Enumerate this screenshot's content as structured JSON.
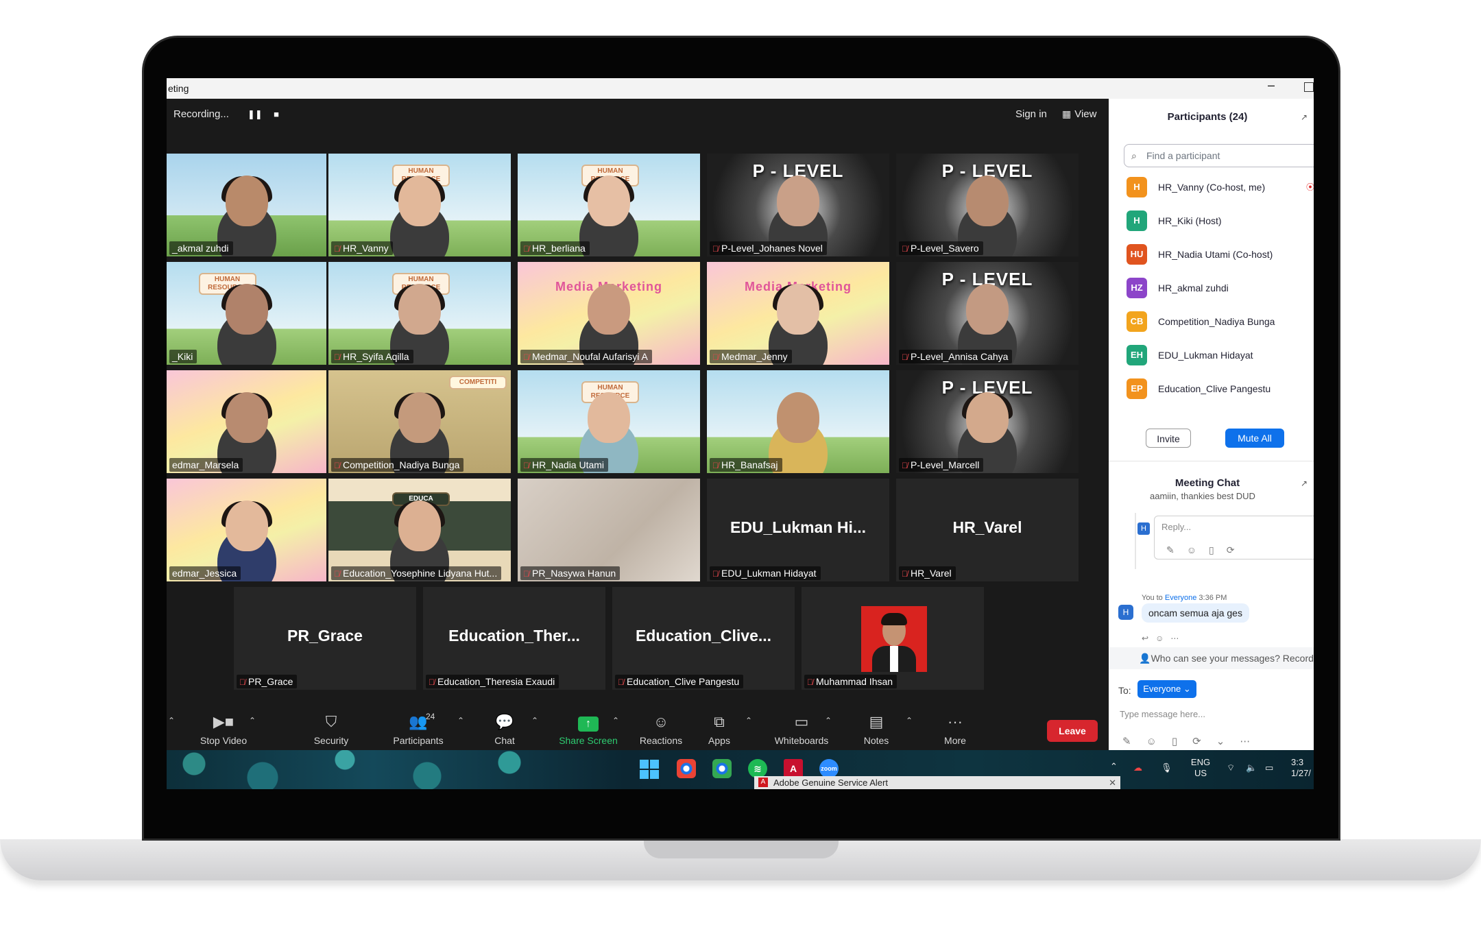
{
  "window": {
    "title": "eting"
  },
  "topbar": {
    "recording_label": "Recording...",
    "pause_icon": "pause-icon",
    "stop_icon": "stop-icon",
    "signin_label": "Sign in",
    "view_label": "View"
  },
  "tiles": [
    {
      "name": "_akmal zuhdi",
      "active": true,
      "muted": false
    },
    {
      "name": "HR_Vanny",
      "muted": true
    },
    {
      "name": "HR_berliana",
      "muted": true
    },
    {
      "name": "P-Level_Johanes Novel",
      "muted": true,
      "banner": "P - LEVEL"
    },
    {
      "name": "P-Level_Savero",
      "muted": true,
      "banner": "P - LEVEL"
    },
    {
      "name": "_Kiki",
      "muted": false
    },
    {
      "name": "HR_Syifa Aqilla",
      "muted": true
    },
    {
      "name": "Medmar_Noufal Aufarisyi A",
      "muted": true
    },
    {
      "name": "Medmar_Jenny",
      "muted": true
    },
    {
      "name": "P-Level_Annisa Cahya",
      "muted": true,
      "banner": "P - LEVEL"
    },
    {
      "name": "edmar_Marsela",
      "muted": false
    },
    {
      "name": "Competition_Nadiya Bunga",
      "muted": true
    },
    {
      "name": "HR_Nadia Utami",
      "muted": true
    },
    {
      "name": "HR_Banafsaj",
      "muted": true
    },
    {
      "name": "P-Level_Marcell",
      "muted": true,
      "banner": "P - LEVEL"
    },
    {
      "name": "edmar_Jessica",
      "muted": false
    },
    {
      "name": "Education_Yosephine Lidyana Hut...",
      "muted": true
    },
    {
      "name": "PR_Nasywa Hanun",
      "muted": true
    },
    {
      "name": "EDU_Lukman Hidayat",
      "muted": true,
      "center": "EDU_Lukman  Hi..."
    },
    {
      "name": "HR_Varel",
      "muted": true,
      "center": "HR_Varel"
    },
    {
      "name": "PR_Grace",
      "muted": true,
      "center": "PR_Grace"
    },
    {
      "name": "Education_Theresia Exaudi",
      "muted": true,
      "center": "Education_Ther..."
    },
    {
      "name": "Education_Clive Pangestu",
      "muted": true,
      "center": "Education_Clive..."
    },
    {
      "name": "Muhammad Ihsan",
      "muted": true
    }
  ],
  "signs": {
    "human_resource": "HUMAN RESOURCE",
    "media_marketing": "Media Marketing",
    "competition": "COMPETITI",
    "education": "EDUCA"
  },
  "toolbar": {
    "stop_video": "Stop Video",
    "security": "Security",
    "participants": "Participants",
    "participants_count": "24",
    "chat": "Chat",
    "share_screen": "Share Screen",
    "reactions": "Reactions",
    "apps": "Apps",
    "whiteboards": "Whiteboards",
    "notes": "Notes",
    "more": "More",
    "leave": "Leave"
  },
  "participants_panel": {
    "title": "Participants (24)",
    "search_placeholder": "Find a participant",
    "people": [
      {
        "initials": "H",
        "name": "HR_Vanny (Co-host, me)",
        "color": "#f2921d"
      },
      {
        "initials": "H",
        "name": "HR_Kiki (Host)",
        "color": "#21a67a"
      },
      {
        "initials": "HU",
        "name": "HR_Nadia Utami (Co-host)",
        "color": "#e0541f"
      },
      {
        "initials": "HZ",
        "name": "HR_akmal zuhdi",
        "color": "#8c45c9"
      },
      {
        "initials": "CB",
        "name": "Competition_Nadiya Bunga",
        "color": "#f2a41d"
      },
      {
        "initials": "EH",
        "name": "EDU_Lukman Hidayat",
        "color": "#21a67a"
      },
      {
        "initials": "EP",
        "name": "Education_Clive Pangestu",
        "color": "#f2921d"
      }
    ],
    "invite": "Invite",
    "mute_all": "Mute All"
  },
  "chat": {
    "title": "Meeting Chat",
    "previous_snippet": "aamiin, thankies best DUD",
    "reply_placeholder": "Reply...",
    "message_meta_from": "You to",
    "message_meta_to": "Everyone",
    "message_meta_time": "3:36 PM",
    "message_text": "oncam semua aja ges",
    "who_can_see": "Who can see your messages? Record",
    "to_label": "To:",
    "to_value": "Everyone",
    "type_placeholder": "Type message here..."
  },
  "taskbar": {
    "alert_text": "Adobe Genuine Service Alert",
    "lang_top": "ENG",
    "lang_bottom": "US",
    "time": "3:3",
    "date": "1/27/"
  }
}
